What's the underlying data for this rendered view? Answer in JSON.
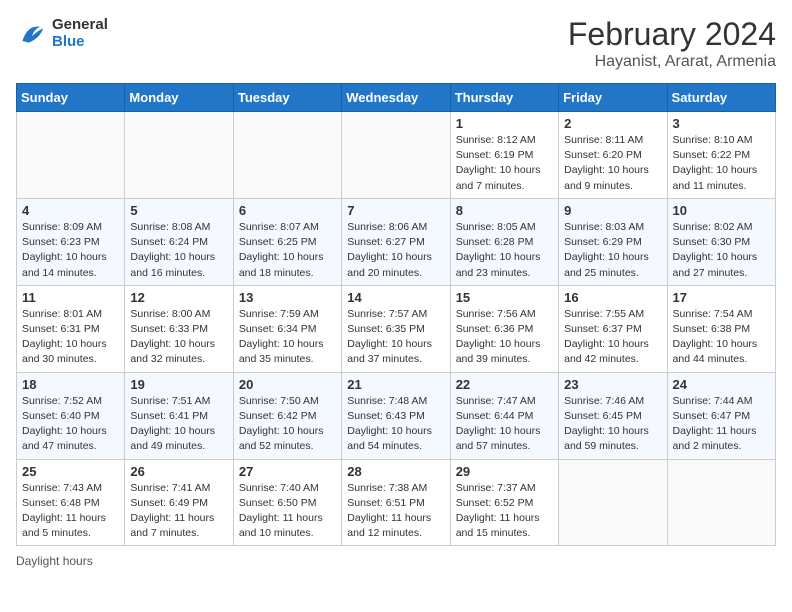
{
  "header": {
    "logo_line1": "General",
    "logo_line2": "Blue",
    "title": "February 2024",
    "location": "Hayanist, Ararat, Armenia"
  },
  "days_of_week": [
    "Sunday",
    "Monday",
    "Tuesday",
    "Wednesday",
    "Thursday",
    "Friday",
    "Saturday"
  ],
  "weeks": [
    [
      {
        "day": "",
        "info": ""
      },
      {
        "day": "",
        "info": ""
      },
      {
        "day": "",
        "info": ""
      },
      {
        "day": "",
        "info": ""
      },
      {
        "day": "1",
        "info": "Sunrise: 8:12 AM\nSunset: 6:19 PM\nDaylight: 10 hours\nand 7 minutes."
      },
      {
        "day": "2",
        "info": "Sunrise: 8:11 AM\nSunset: 6:20 PM\nDaylight: 10 hours\nand 9 minutes."
      },
      {
        "day": "3",
        "info": "Sunrise: 8:10 AM\nSunset: 6:22 PM\nDaylight: 10 hours\nand 11 minutes."
      }
    ],
    [
      {
        "day": "4",
        "info": "Sunrise: 8:09 AM\nSunset: 6:23 PM\nDaylight: 10 hours\nand 14 minutes."
      },
      {
        "day": "5",
        "info": "Sunrise: 8:08 AM\nSunset: 6:24 PM\nDaylight: 10 hours\nand 16 minutes."
      },
      {
        "day": "6",
        "info": "Sunrise: 8:07 AM\nSunset: 6:25 PM\nDaylight: 10 hours\nand 18 minutes."
      },
      {
        "day": "7",
        "info": "Sunrise: 8:06 AM\nSunset: 6:27 PM\nDaylight: 10 hours\nand 20 minutes."
      },
      {
        "day": "8",
        "info": "Sunrise: 8:05 AM\nSunset: 6:28 PM\nDaylight: 10 hours\nand 23 minutes."
      },
      {
        "day": "9",
        "info": "Sunrise: 8:03 AM\nSunset: 6:29 PM\nDaylight: 10 hours\nand 25 minutes."
      },
      {
        "day": "10",
        "info": "Sunrise: 8:02 AM\nSunset: 6:30 PM\nDaylight: 10 hours\nand 27 minutes."
      }
    ],
    [
      {
        "day": "11",
        "info": "Sunrise: 8:01 AM\nSunset: 6:31 PM\nDaylight: 10 hours\nand 30 minutes."
      },
      {
        "day": "12",
        "info": "Sunrise: 8:00 AM\nSunset: 6:33 PM\nDaylight: 10 hours\nand 32 minutes."
      },
      {
        "day": "13",
        "info": "Sunrise: 7:59 AM\nSunset: 6:34 PM\nDaylight: 10 hours\nand 35 minutes."
      },
      {
        "day": "14",
        "info": "Sunrise: 7:57 AM\nSunset: 6:35 PM\nDaylight: 10 hours\nand 37 minutes."
      },
      {
        "day": "15",
        "info": "Sunrise: 7:56 AM\nSunset: 6:36 PM\nDaylight: 10 hours\nand 39 minutes."
      },
      {
        "day": "16",
        "info": "Sunrise: 7:55 AM\nSunset: 6:37 PM\nDaylight: 10 hours\nand 42 minutes."
      },
      {
        "day": "17",
        "info": "Sunrise: 7:54 AM\nSunset: 6:38 PM\nDaylight: 10 hours\nand 44 minutes."
      }
    ],
    [
      {
        "day": "18",
        "info": "Sunrise: 7:52 AM\nSunset: 6:40 PM\nDaylight: 10 hours\nand 47 minutes."
      },
      {
        "day": "19",
        "info": "Sunrise: 7:51 AM\nSunset: 6:41 PM\nDaylight: 10 hours\nand 49 minutes."
      },
      {
        "day": "20",
        "info": "Sunrise: 7:50 AM\nSunset: 6:42 PM\nDaylight: 10 hours\nand 52 minutes."
      },
      {
        "day": "21",
        "info": "Sunrise: 7:48 AM\nSunset: 6:43 PM\nDaylight: 10 hours\nand 54 minutes."
      },
      {
        "day": "22",
        "info": "Sunrise: 7:47 AM\nSunset: 6:44 PM\nDaylight: 10 hours\nand 57 minutes."
      },
      {
        "day": "23",
        "info": "Sunrise: 7:46 AM\nSunset: 6:45 PM\nDaylight: 10 hours\nand 59 minutes."
      },
      {
        "day": "24",
        "info": "Sunrise: 7:44 AM\nSunset: 6:47 PM\nDaylight: 11 hours\nand 2 minutes."
      }
    ],
    [
      {
        "day": "25",
        "info": "Sunrise: 7:43 AM\nSunset: 6:48 PM\nDaylight: 11 hours\nand 5 minutes."
      },
      {
        "day": "26",
        "info": "Sunrise: 7:41 AM\nSunset: 6:49 PM\nDaylight: 11 hours\nand 7 minutes."
      },
      {
        "day": "27",
        "info": "Sunrise: 7:40 AM\nSunset: 6:50 PM\nDaylight: 11 hours\nand 10 minutes."
      },
      {
        "day": "28",
        "info": "Sunrise: 7:38 AM\nSunset: 6:51 PM\nDaylight: 11 hours\nand 12 minutes."
      },
      {
        "day": "29",
        "info": "Sunrise: 7:37 AM\nSunset: 6:52 PM\nDaylight: 11 hours\nand 15 minutes."
      },
      {
        "day": "",
        "info": ""
      },
      {
        "day": "",
        "info": ""
      }
    ]
  ],
  "footer": {
    "daylight_label": "Daylight hours"
  }
}
